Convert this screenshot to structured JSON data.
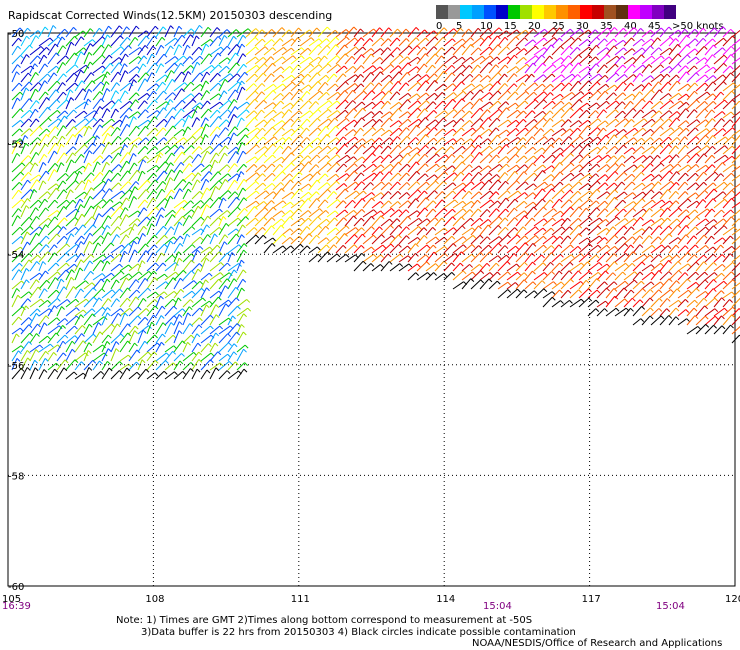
{
  "title": "Rapidscat Corrected Winds(12.5KM) 20150303 descending",
  "legend": {
    "colors": [
      "#555555",
      "#999999",
      "#00c8ff",
      "#00a0ff",
      "#0050ff",
      "#0000c8",
      "#00c800",
      "#a0e000",
      "#ffff00",
      "#ffc800",
      "#ff9000",
      "#ff6000",
      "#ff0000",
      "#c80000",
      "#a05020",
      "#603010",
      "#ff00ff",
      "#c000ff",
      "#8000c0",
      "#400080"
    ],
    "labels": [
      "0",
      "5",
      "10",
      "15",
      "20",
      "25",
      "30",
      "35",
      "40",
      "45",
      ">50 knots"
    ]
  },
  "lat_labels": [
    "-50",
    "-52",
    "-54",
    "-56",
    "-58",
    "-60"
  ],
  "lon_labels": [
    "105",
    "108",
    "111",
    "114",
    "117",
    "120"
  ],
  "time_labels": [
    "16:39",
    "15:04",
    "15:04"
  ],
  "notes": [
    "Note: 1) Times are GMT 2)Times along bottom correspond to measurement at -50S",
    "3)Data buffer is 22 hrs from 20150303 4) Black circles indicate possible contamination"
  ],
  "credit": "NOAA/NESDIS/Office of Research and Applications"
}
